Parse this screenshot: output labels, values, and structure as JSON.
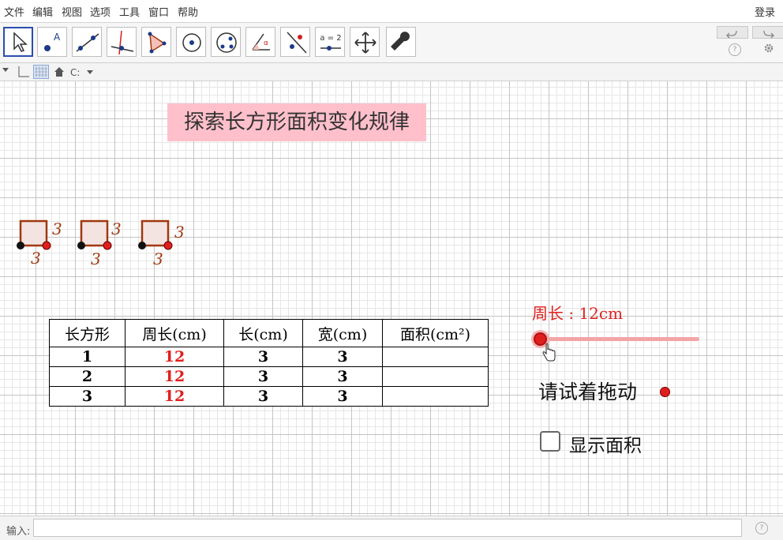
{
  "menu": {
    "items": [
      {
        "id": "file",
        "label": "文件"
      },
      {
        "id": "edit",
        "label": "编辑"
      },
      {
        "id": "view",
        "label": "视图"
      },
      {
        "id": "options",
        "label": "选项"
      },
      {
        "id": "tools",
        "label": "工具"
      },
      {
        "id": "window",
        "label": "窗口"
      },
      {
        "id": "help",
        "label": "帮助"
      }
    ],
    "login": "登录"
  },
  "toolbar": {
    "tools": [
      "move-tool",
      "point-tool",
      "line-tool",
      "perpendicular-tool",
      "polygon-tool",
      "circle-tool",
      "conic-tool",
      "angle-tool",
      "reflect-tool",
      "slider-tool",
      "move-view-tool",
      "customize-tool"
    ],
    "slider_tool_label": "a = 2"
  },
  "graphics": {
    "title": "探索长方形面积变化规律",
    "shapes": [
      {
        "width_label": "3",
        "height_label": "3"
      },
      {
        "width_label": "3",
        "height_label": "3"
      },
      {
        "width_label": "3",
        "height_label": "3"
      }
    ],
    "table": {
      "headers": [
        "长方形",
        "周长(cm)",
        "长(cm)",
        "宽(cm)",
        "面积(cm²)"
      ],
      "rows": [
        {
          "id": "1",
          "perimeter": "12",
          "length": "3",
          "width": "3",
          "area": ""
        },
        {
          "id": "2",
          "perimeter": "12",
          "length": "3",
          "width": "3",
          "area": ""
        },
        {
          "id": "3",
          "perimeter": "12",
          "length": "3",
          "width": "3",
          "area": ""
        }
      ]
    },
    "slider": {
      "label": "周长 : 12cm",
      "value": 12,
      "fraction": 0.0
    },
    "drag_hint": "请试着拖动",
    "checkbox": {
      "label": "显示面积",
      "checked": false
    }
  },
  "input_bar": {
    "label": "输入:",
    "value": ""
  },
  "colors": {
    "accent": "#e0201e",
    "title_bg": "#ffc0cb",
    "shape_edge": "#a0380f",
    "shape_fill": "#f3e4e2",
    "selected_tool": "#2a4dae"
  }
}
